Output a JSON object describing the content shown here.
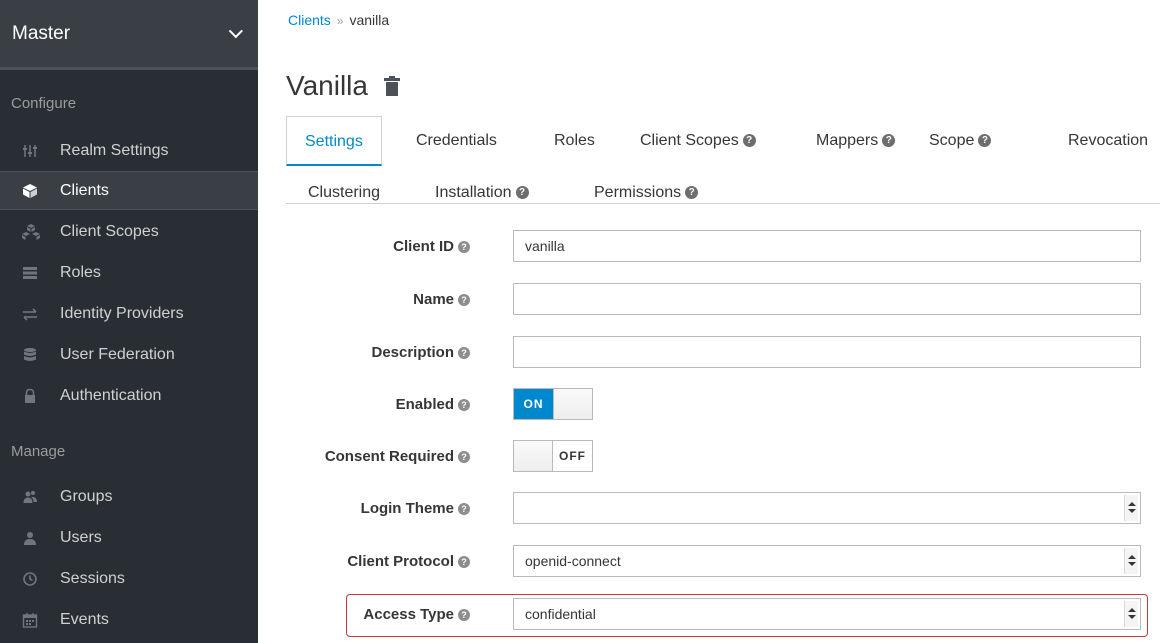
{
  "sidebar": {
    "realm": "Master",
    "configure_title": "Configure",
    "manage_title": "Manage",
    "configure_items": [
      {
        "label": "Realm Settings",
        "icon": "sliders-icon",
        "active": false
      },
      {
        "label": "Clients",
        "icon": "cube-icon",
        "active": true
      },
      {
        "label": "Client Scopes",
        "icon": "cubes-icon",
        "active": false
      },
      {
        "label": "Roles",
        "icon": "list-icon",
        "active": false
      },
      {
        "label": "Identity Providers",
        "icon": "exchange-icon",
        "active": false
      },
      {
        "label": "User Federation",
        "icon": "database-icon",
        "active": false
      },
      {
        "label": "Authentication",
        "icon": "lock-icon",
        "active": false
      }
    ],
    "manage_items": [
      {
        "label": "Groups",
        "icon": "users-group-icon"
      },
      {
        "label": "Users",
        "icon": "user-icon"
      },
      {
        "label": "Sessions",
        "icon": "clock-icon"
      },
      {
        "label": "Events",
        "icon": "calendar-icon"
      }
    ]
  },
  "breadcrumb": {
    "parent": "Clients",
    "separator": "»",
    "current": "vanilla"
  },
  "page_title": "Vanilla",
  "tabs": {
    "row1": [
      "Settings",
      "Credentials",
      "Roles",
      "Client Scopes",
      "Mappers",
      "Scope",
      "Revocation"
    ],
    "row2": [
      "Clustering",
      "Installation",
      "Permissions"
    ],
    "active": "Settings"
  },
  "form": {
    "client_id": {
      "label": "Client ID",
      "value": "vanilla"
    },
    "name": {
      "label": "Name",
      "value": ""
    },
    "description": {
      "label": "Description",
      "value": ""
    },
    "enabled": {
      "label": "Enabled",
      "state": "ON"
    },
    "consent": {
      "label": "Consent Required",
      "state": "OFF"
    },
    "login_theme": {
      "label": "Login Theme",
      "value": ""
    },
    "client_protocol": {
      "label": "Client Protocol",
      "value": "openid-connect"
    },
    "access_type": {
      "label": "Access Type",
      "value": "confidential"
    }
  },
  "colors": {
    "accent": "#0088ce",
    "highlight": "#c9373c",
    "sidebar": "#292e34"
  }
}
